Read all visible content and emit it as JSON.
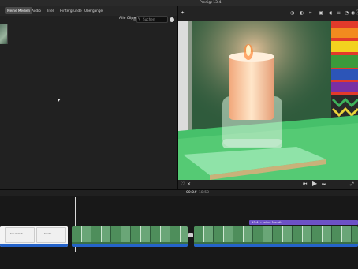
{
  "window": {
    "title": "Predigt 13.4."
  },
  "tabs": [
    {
      "label": "Meine Medien",
      "active": true
    },
    {
      "label": "Audio",
      "active": false
    },
    {
      "label": "Titel",
      "active": false
    },
    {
      "label": "Hintergründe",
      "active": false
    },
    {
      "label": "Übergänge",
      "active": false
    }
  ],
  "browser": {
    "filter_label": "Alle Clips",
    "search_placeholder": "Suchen"
  },
  "playback": {
    "current_time": "00:04",
    "separator": "/",
    "total_time": "18:53"
  },
  "timeline": {
    "title_clip_label": "13.4. – Lehre Mundt",
    "card_texts": [
      "Sei ehrlich",
      "Kirche"
    ]
  },
  "colors": {
    "accent": "#2563c9",
    "title_clip": "#6d52c6",
    "playhead": "#d9d9d9"
  },
  "icons": [
    "magic-wand-icon",
    "color-balance-icon",
    "color-correction-icon",
    "crop-icon",
    "stabilization-icon",
    "volume-icon",
    "equalizer-icon",
    "speed-icon",
    "noise-reduction-icon",
    "info-icon",
    "favorite-icon",
    "fullscreen-icon",
    "skip-back-icon",
    "play-icon",
    "skip-forward-icon",
    "settings-icon",
    "search-icon"
  ]
}
